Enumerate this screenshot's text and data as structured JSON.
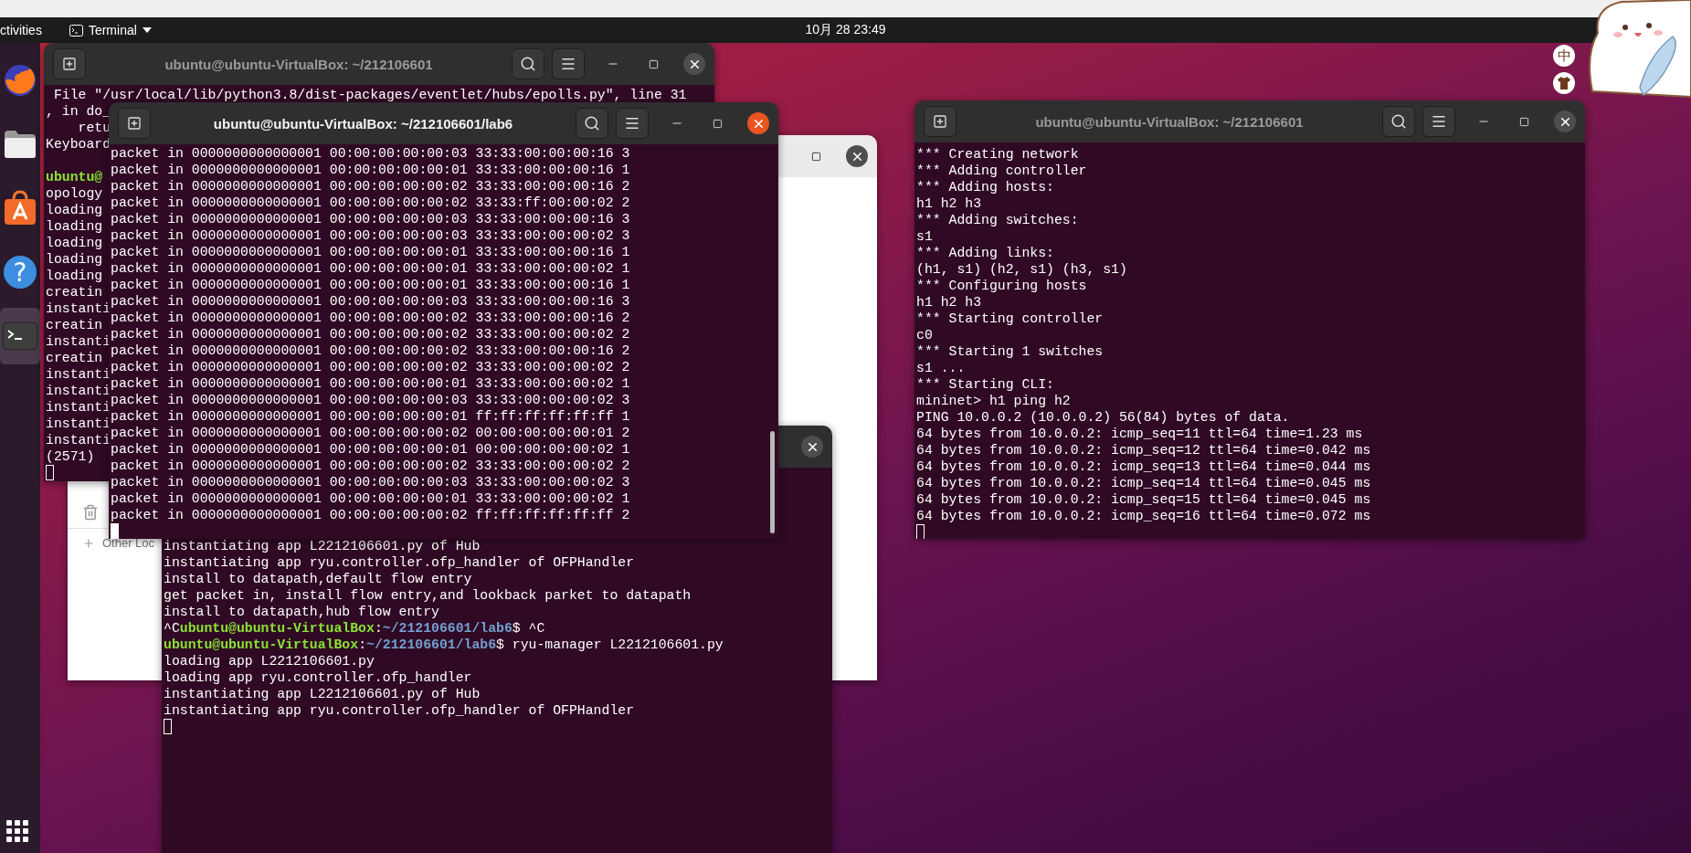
{
  "top_bar": {
    "activities": "ctivities",
    "app_menu": "Terminal",
    "clock": "10月 28 23:49"
  },
  "input_indicators": [
    {
      "kind": "text",
      "label": "中"
    },
    {
      "kind": "icon"
    }
  ],
  "dock": [
    {
      "kind": "browser",
      "selected": false
    },
    {
      "kind": "files",
      "selected": false
    },
    {
      "kind": "software",
      "selected": false
    },
    {
      "kind": "help",
      "glyph": "?",
      "selected": false
    },
    {
      "kind": "terminal",
      "selected": true
    }
  ],
  "files_window": {
    "sidebar": [
      {
        "kind": "trash"
      },
      {
        "kind": "other",
        "label": "Other Loc"
      }
    ]
  },
  "terminal_back": {
    "title": "ubuntu@ubuntu-VirtualBox: ~/212106601",
    "active": false,
    "lines": [
      {
        "kind": "out",
        "text": " File \"/usr/local/lib/python3.8/dist-packages/eventlet/hubs/epolls.py\", line 31"
      },
      {
        "kind": "out",
        "text": ", in do_"
      },
      {
        "kind": "out",
        "text": "    retu"
      },
      {
        "kind": "out",
        "text": "Keyboard"
      },
      {
        "kind": "blank"
      },
      {
        "kind": "prompt",
        "user": "ubuntu@"
      },
      {
        "kind": "out",
        "text": "opology"
      },
      {
        "kind": "out",
        "text": "loading"
      },
      {
        "kind": "out",
        "text": "loading"
      },
      {
        "kind": "out",
        "text": "loading"
      },
      {
        "kind": "out",
        "text": "loading"
      },
      {
        "kind": "out",
        "text": "loading"
      },
      {
        "kind": "out",
        "text": "creatin"
      },
      {
        "kind": "out",
        "text": "instanti"
      },
      {
        "kind": "out",
        "text": "creatin"
      },
      {
        "kind": "out",
        "text": "instanti"
      },
      {
        "kind": "out",
        "text": "creatin"
      },
      {
        "kind": "out",
        "text": "instanti"
      },
      {
        "kind": "out",
        "text": "instanti"
      },
      {
        "kind": "out",
        "text": "instanti"
      },
      {
        "kind": "out",
        "text": "instanti"
      },
      {
        "kind": "out",
        "text": "instanti"
      },
      {
        "kind": "out",
        "text": "(2571)"
      }
    ]
  },
  "terminal_lower": {
    "active": false,
    "lines": [
      {
        "kind": "out",
        "text": "instantiating app L2212106601.py of Hub"
      },
      {
        "kind": "out",
        "text": "instantiating app ryu.controller.ofp_handler of OFPHandler"
      },
      {
        "kind": "out",
        "text": "install to datapath,default flow entry"
      },
      {
        "kind": "out",
        "text": "get packet in, install flow entry,and lookback parket to datapath"
      },
      {
        "kind": "out",
        "text": "install to datapath,hub flow entry"
      },
      {
        "kind": "prompt",
        "pre": "^C",
        "user": "ubuntu@ubuntu-VirtualBox",
        "sep": ":",
        "path": "~/212106601/lab6",
        "cmd": "$ ^C"
      },
      {
        "kind": "prompt",
        "user": "ubuntu@ubuntu-VirtualBox",
        "sep": ":",
        "path": "~/212106601/lab6",
        "cmd": "$ ryu-manager L2212106601.py"
      },
      {
        "kind": "out",
        "text": "loading app L2212106601.py"
      },
      {
        "kind": "out",
        "text": "loading app ryu.controller.ofp_handler"
      },
      {
        "kind": "out",
        "text": "instantiating app L2212106601.py of Hub"
      },
      {
        "kind": "out",
        "text": "instantiating app ryu.controller.ofp_handler of OFPHandler"
      }
    ]
  },
  "terminal_front": {
    "title": "ubuntu@ubuntu-VirtualBox: ~/212106601/lab6",
    "active": true,
    "lines": [
      {
        "kind": "out",
        "text": "packet in 0000000000000001 00:00:00:00:00:03 33:33:00:00:00:16 3"
      },
      {
        "kind": "out",
        "text": "packet in 0000000000000001 00:00:00:00:00:01 33:33:00:00:00:16 1"
      },
      {
        "kind": "out",
        "text": "packet in 0000000000000001 00:00:00:00:00:02 33:33:00:00:00:16 2"
      },
      {
        "kind": "out",
        "text": "packet in 0000000000000001 00:00:00:00:00:02 33:33:ff:00:00:02 2"
      },
      {
        "kind": "out",
        "text": "packet in 0000000000000001 00:00:00:00:00:03 33:33:00:00:00:16 3"
      },
      {
        "kind": "out",
        "text": "packet in 0000000000000001 00:00:00:00:00:03 33:33:00:00:00:02 3"
      },
      {
        "kind": "out",
        "text": "packet in 0000000000000001 00:00:00:00:00:01 33:33:00:00:00:16 1"
      },
      {
        "kind": "out",
        "text": "packet in 0000000000000001 00:00:00:00:00:01 33:33:00:00:00:02 1"
      },
      {
        "kind": "out",
        "text": "packet in 0000000000000001 00:00:00:00:00:01 33:33:00:00:00:16 1"
      },
      {
        "kind": "out",
        "text": "packet in 0000000000000001 00:00:00:00:00:03 33:33:00:00:00:16 3"
      },
      {
        "kind": "out",
        "text": "packet in 0000000000000001 00:00:00:00:00:02 33:33:00:00:00:16 2"
      },
      {
        "kind": "out",
        "text": "packet in 0000000000000001 00:00:00:00:00:02 33:33:00:00:00:02 2"
      },
      {
        "kind": "out",
        "text": "packet in 0000000000000001 00:00:00:00:00:02 33:33:00:00:00:16 2"
      },
      {
        "kind": "out",
        "text": "packet in 0000000000000001 00:00:00:00:00:02 33:33:00:00:00:02 2"
      },
      {
        "kind": "out",
        "text": "packet in 0000000000000001 00:00:00:00:00:01 33:33:00:00:00:02 1"
      },
      {
        "kind": "out",
        "text": "packet in 0000000000000001 00:00:00:00:00:03 33:33:00:00:00:02 3"
      },
      {
        "kind": "out",
        "text": "packet in 0000000000000001 00:00:00:00:00:01 ff:ff:ff:ff:ff:ff 1"
      },
      {
        "kind": "out",
        "text": "packet in 0000000000000001 00:00:00:00:00:02 00:00:00:00:00:01 2"
      },
      {
        "kind": "out",
        "text": "packet in 0000000000000001 00:00:00:00:00:01 00:00:00:00:00:02 1"
      },
      {
        "kind": "out",
        "text": "packet in 0000000000000001 00:00:00:00:00:02 33:33:00:00:00:02 2"
      },
      {
        "kind": "out",
        "text": "packet in 0000000000000001 00:00:00:00:00:03 33:33:00:00:00:02 3"
      },
      {
        "kind": "out",
        "text": "packet in 0000000000000001 00:00:00:00:00:01 33:33:00:00:00:02 1"
      },
      {
        "kind": "out",
        "text": "packet in 0000000000000001 00:00:00:00:00:02 ff:ff:ff:ff:ff:ff 2"
      }
    ]
  },
  "terminal_right": {
    "title": "ubuntu@ubuntu-VirtualBox: ~/212106601",
    "active": false,
    "lines": [
      {
        "kind": "out",
        "text": "*** Creating network"
      },
      {
        "kind": "out",
        "text": "*** Adding controller"
      },
      {
        "kind": "out",
        "text": "*** Adding hosts:"
      },
      {
        "kind": "out",
        "text": "h1 h2 h3"
      },
      {
        "kind": "out",
        "text": "*** Adding switches:"
      },
      {
        "kind": "out",
        "text": "s1"
      },
      {
        "kind": "out",
        "text": "*** Adding links:"
      },
      {
        "kind": "out",
        "text": "(h1, s1) (h2, s1) (h3, s1)"
      },
      {
        "kind": "out",
        "text": "*** Configuring hosts"
      },
      {
        "kind": "out",
        "text": "h1 h2 h3"
      },
      {
        "kind": "out",
        "text": "*** Starting controller"
      },
      {
        "kind": "out",
        "text": "c0"
      },
      {
        "kind": "out",
        "text": "*** Starting 1 switches"
      },
      {
        "kind": "out",
        "text": "s1 ..."
      },
      {
        "kind": "out",
        "text": "*** Starting CLI:"
      },
      {
        "kind": "out",
        "text": "mininet> h1 ping h2"
      },
      {
        "kind": "out",
        "text": "PING 10.0.0.2 (10.0.0.2) 56(84) bytes of data."
      },
      {
        "kind": "out",
        "text": "64 bytes from 10.0.0.2: icmp_seq=11 ttl=64 time=1.23 ms"
      },
      {
        "kind": "out",
        "text": "64 bytes from 10.0.0.2: icmp_seq=12 ttl=64 time=0.042 ms"
      },
      {
        "kind": "out",
        "text": "64 bytes from 10.0.0.2: icmp_seq=13 ttl=64 time=0.044 ms"
      },
      {
        "kind": "out",
        "text": "64 bytes from 10.0.0.2: icmp_seq=14 ttl=64 time=0.045 ms"
      },
      {
        "kind": "out",
        "text": "64 bytes from 10.0.0.2: icmp_seq=15 ttl=64 time=0.045 ms"
      },
      {
        "kind": "out",
        "text": "64 bytes from 10.0.0.2: icmp_seq=16 ttl=64 time=0.072 ms"
      }
    ]
  }
}
